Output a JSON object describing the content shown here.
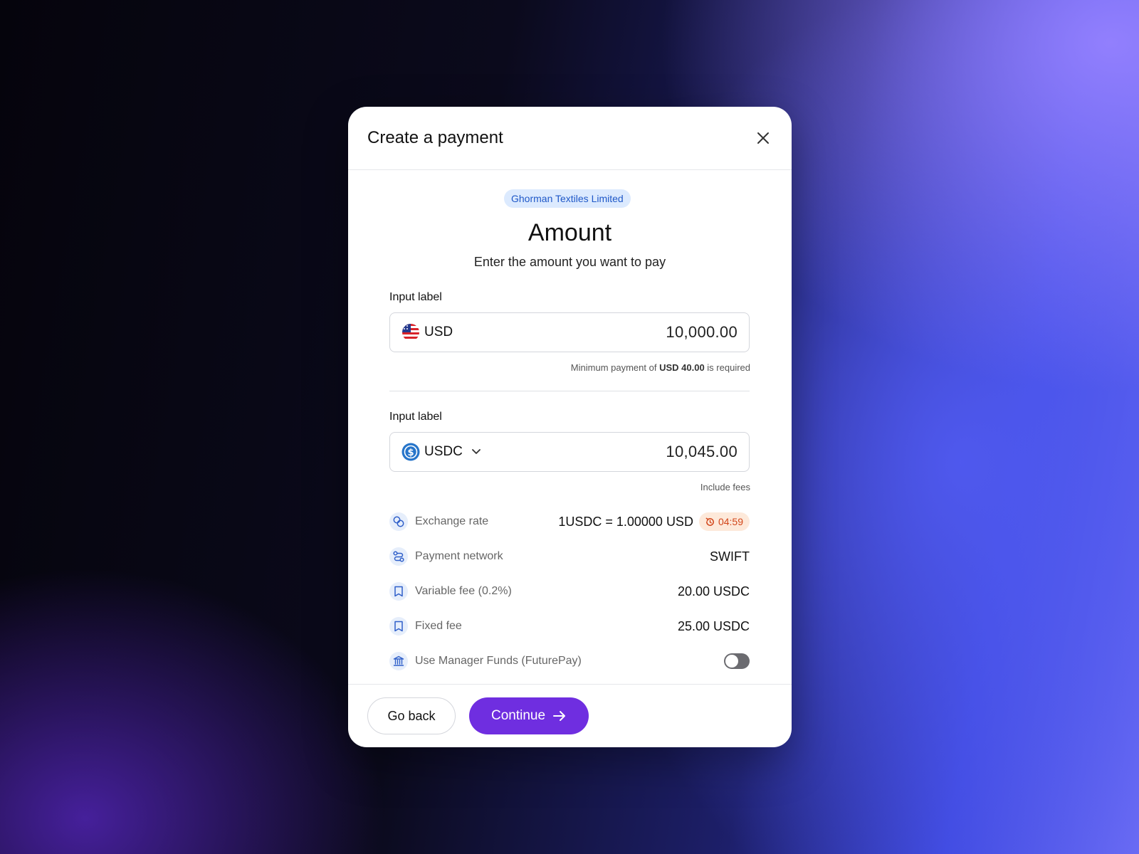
{
  "modal": {
    "title": "Create a payment",
    "company_badge": "Ghorman Textiles Limited",
    "heading": "Amount",
    "subheading": "Enter the amount you want to pay"
  },
  "send_field": {
    "label": "Input label",
    "currency": "USD",
    "amount": "10,000.00",
    "hint_prefix": "Minimum payment of",
    "hint_amount": "USD 40.00",
    "hint_suffix": "is required"
  },
  "receive_field": {
    "label": "Input label",
    "currency": "USDC",
    "amount": "10,045.00",
    "hint": "Include fees"
  },
  "details": {
    "exchange_rate": {
      "label": "Exchange rate",
      "value": "1USDC = 1.00000 USD",
      "timer": "04:59",
      "icon": "exchange-icon"
    },
    "payment_network": {
      "label": "Payment network",
      "value": "SWIFT",
      "icon": "route-icon"
    },
    "variable_fee": {
      "label": "Variable fee (0.2%)",
      "value": "20.00 USDC",
      "icon": "receipt-icon"
    },
    "fixed_fee": {
      "label": "Fixed fee",
      "value": "25.00 USDC",
      "icon": "receipt-icon"
    },
    "manager_funds": {
      "label": "Use Manager Funds (FuturePay)",
      "enabled": false,
      "icon": "bank-icon"
    }
  },
  "footer": {
    "back_label": "Go back",
    "continue_label": "Continue"
  },
  "colors": {
    "accent": "#6f2ee0",
    "badge_bg": "#dceafe",
    "badge_text": "#1f58c8",
    "timer_bg": "#fde9da",
    "timer_text": "#d2461a"
  }
}
